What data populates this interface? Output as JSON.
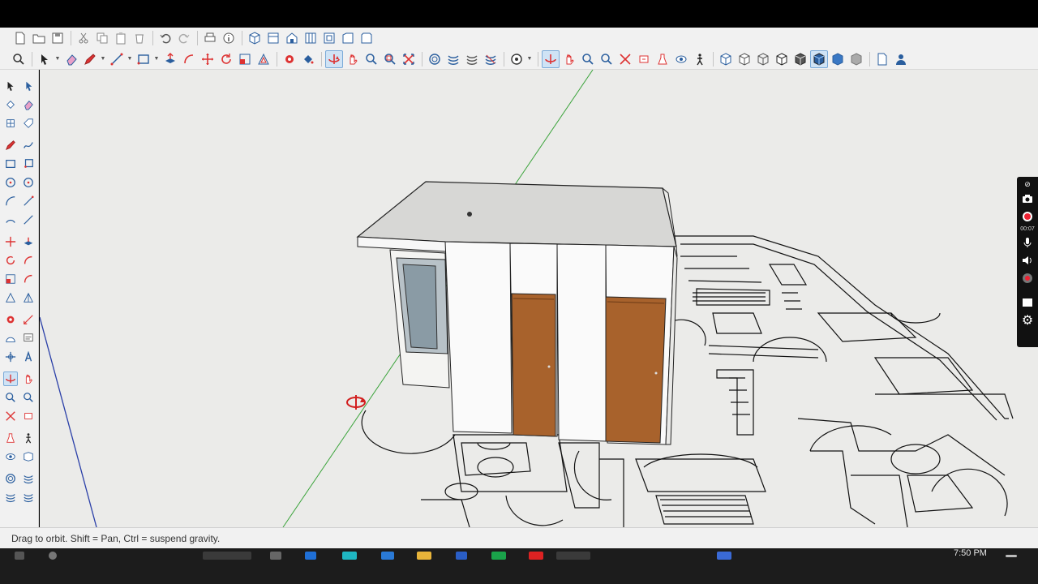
{
  "toolbar1": {
    "items": [
      "new-file-icon",
      "open-folder-icon",
      "save-icon",
      "cut-icon",
      "copy-icon",
      "paste-icon",
      "erase-icon",
      "undo-icon",
      "redo-icon",
      "print-icon",
      "model-info-icon",
      "iso-view-icon",
      "top-view-icon",
      "front-view-icon",
      "right-view-icon",
      "back-view-icon",
      "left-view-icon"
    ]
  },
  "toolbar2": {
    "items": [
      "search-icon",
      "select-icon",
      "eraser-icon",
      "pencil-icon",
      "line-icon",
      "rectangle-icon",
      "push-pull-icon",
      "move-icon",
      "rotate-icon",
      "scale-icon",
      "offset-icon",
      "tape-measure-icon",
      "paint-bucket-icon",
      "orbit-icon",
      "pan-icon",
      "zoom-icon",
      "zoom-extents-icon",
      "section-plane-icon",
      "walk-icon",
      "look-around-icon",
      "position-camera-icon",
      "xray-icon",
      "wireframe-icon",
      "hidden-line-icon",
      "shaded-icon",
      "shaded-textures-icon",
      "monochrome-icon",
      "component-icon",
      "person-icon"
    ],
    "active": "orbit-icon"
  },
  "left_tools": {
    "active": "orbit-icon"
  },
  "recorder": {
    "time": "00:07"
  },
  "status": {
    "message": "Drag to orbit. Shift = Pan, Ctrl = suspend gravity."
  },
  "taskbar": {
    "time": "7:50 PM"
  },
  "colors": {
    "accent_active": "#cfe3f5",
    "viewport_bg": "#ebebe9",
    "door_wood": "#a8622c",
    "axis_green": "#3aa33a",
    "axis_blue": "#2a3fa8",
    "orbit_red": "#d21f1f"
  }
}
